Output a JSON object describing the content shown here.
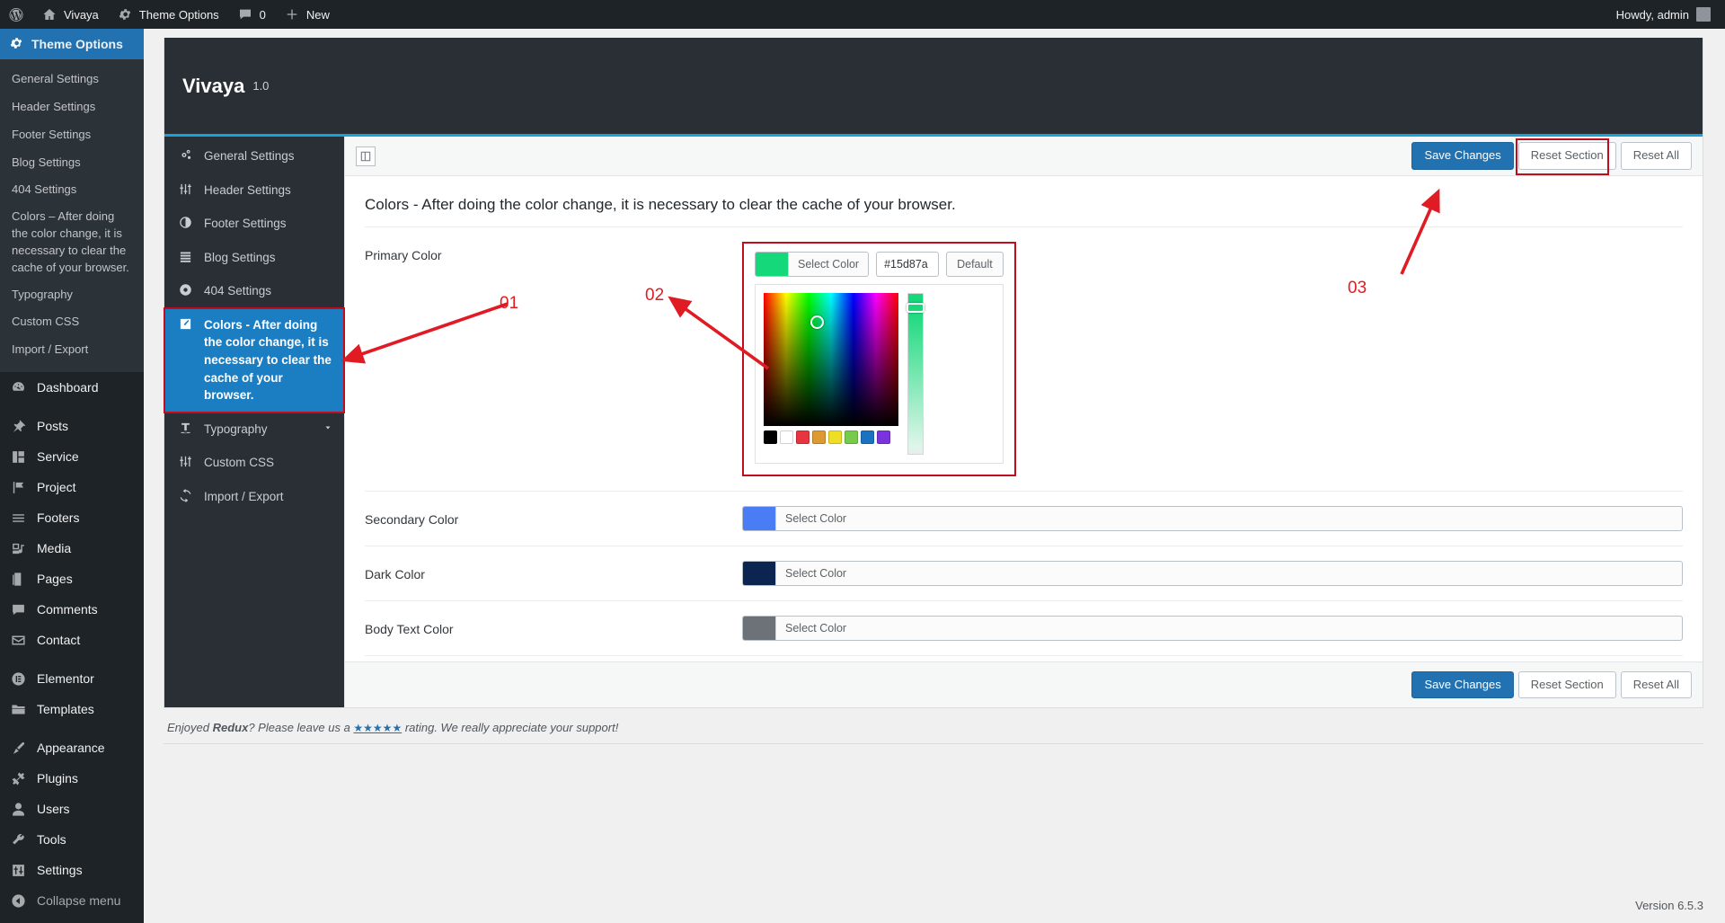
{
  "adminbar": {
    "wp_logo": "wordpress-logo-icon",
    "site_name": "Vivaya",
    "theme_options": "Theme Options",
    "comments_count": "0",
    "new_label": "New",
    "howdy": "Howdy, admin"
  },
  "adminmenu": {
    "current": {
      "label": "Theme Options",
      "icon": "gear-icon"
    },
    "submenu": [
      {
        "label": "General Settings"
      },
      {
        "label": "Header Settings"
      },
      {
        "label": "Footer Settings"
      },
      {
        "label": "Blog Settings"
      },
      {
        "label": "404 Settings"
      },
      {
        "label": "Colors – After doing the color change, it is necessary to clear the cache of your browser."
      },
      {
        "label": "Typography"
      },
      {
        "label": "Custom CSS"
      },
      {
        "label": "Import / Export"
      }
    ],
    "items": [
      {
        "label": "Dashboard",
        "icon": "dashboard-icon"
      },
      {
        "label": "Posts",
        "icon": "pin-icon"
      },
      {
        "label": "Service",
        "icon": "blocks-icon"
      },
      {
        "label": "Project",
        "icon": "flag-icon"
      },
      {
        "label": "Footers",
        "icon": "menu-lines-icon"
      },
      {
        "label": "Media",
        "icon": "media-icon"
      },
      {
        "label": "Pages",
        "icon": "pages-icon"
      },
      {
        "label": "Comments",
        "icon": "comment-icon"
      },
      {
        "label": "Contact",
        "icon": "envelope-icon"
      },
      {
        "label": "Elementor",
        "icon": "elementor-icon"
      },
      {
        "label": "Templates",
        "icon": "folder-icon"
      },
      {
        "label": "Appearance",
        "icon": "brush-icon"
      },
      {
        "label": "Plugins",
        "icon": "plug-icon"
      },
      {
        "label": "Users",
        "icon": "user-icon"
      },
      {
        "label": "Tools",
        "icon": "wrench-icon"
      },
      {
        "label": "Settings",
        "icon": "sliders-icon"
      },
      {
        "label": "Collapse menu",
        "icon": "collapse-icon"
      }
    ]
  },
  "panel": {
    "title": "Vivaya",
    "version": "1.0",
    "tabs": [
      {
        "label": "General Settings",
        "icon": "gears-icon"
      },
      {
        "label": "Header Settings",
        "icon": "sliders-icon"
      },
      {
        "label": "Footer Settings",
        "icon": "contrast-circle-icon"
      },
      {
        "label": "Blog Settings",
        "icon": "list-icon"
      },
      {
        "label": "404 Settings",
        "icon": "cog-circle-icon"
      },
      {
        "label": "Colors - After doing the color change, it is necessary to clear the cache of your browser.",
        "icon": "edit-square-icon"
      },
      {
        "label": "Typography",
        "icon": "text-size-icon"
      },
      {
        "label": "Custom CSS",
        "icon": "sliders-icon"
      },
      {
        "label": "Import / Export",
        "icon": "sync-icon"
      }
    ],
    "toolbar": {
      "expand_icon": "expand-panel-icon",
      "save_label": "Save Changes",
      "reset_section_label": "Reset Section",
      "reset_all_label": "Reset All"
    },
    "section_heading": "Colors - After doing the color change, it is necessary to clear the cache of your browser.",
    "options": [
      {
        "label": "Primary Color",
        "select_label": "Select Color",
        "swatch": "#15d87a",
        "hex_value": "#15d87a",
        "default_label": "Default",
        "open": true
      },
      {
        "label": "Secondary Color",
        "select_label": "Select Color",
        "swatch": "#4a7cf5",
        "open": false
      },
      {
        "label": "Dark Color",
        "select_label": "Select Color",
        "swatch": "#0b2450",
        "open": false
      },
      {
        "label": "Body Text Color",
        "select_label": "Select Color",
        "swatch": "#6d7278",
        "open": false
      }
    ],
    "picker_swatches": [
      "#000000",
      "#ffffff",
      "#e8343f",
      "#dd9a33",
      "#eede25",
      "#76cb4a",
      "#1a72c0",
      "#7b34dd"
    ],
    "credits_pre": "Enjoyed ",
    "credits_brand": "Redux",
    "credits_mid": "? Please leave us a ",
    "credits_stars": "★★★★★",
    "credits_post": " rating. We really appreciate your support!"
  },
  "wpfooter": {
    "version": "Version 6.5.3"
  },
  "annotations": [
    {
      "number": "01"
    },
    {
      "number": "02"
    },
    {
      "number": "03"
    }
  ],
  "colors": {
    "accent_blue": "#2271b1",
    "redux_blue": "#1c7ec2",
    "annotation_red": "#e01b24",
    "dark_panel": "#2a2f36",
    "admin_dark": "#1d2327"
  }
}
